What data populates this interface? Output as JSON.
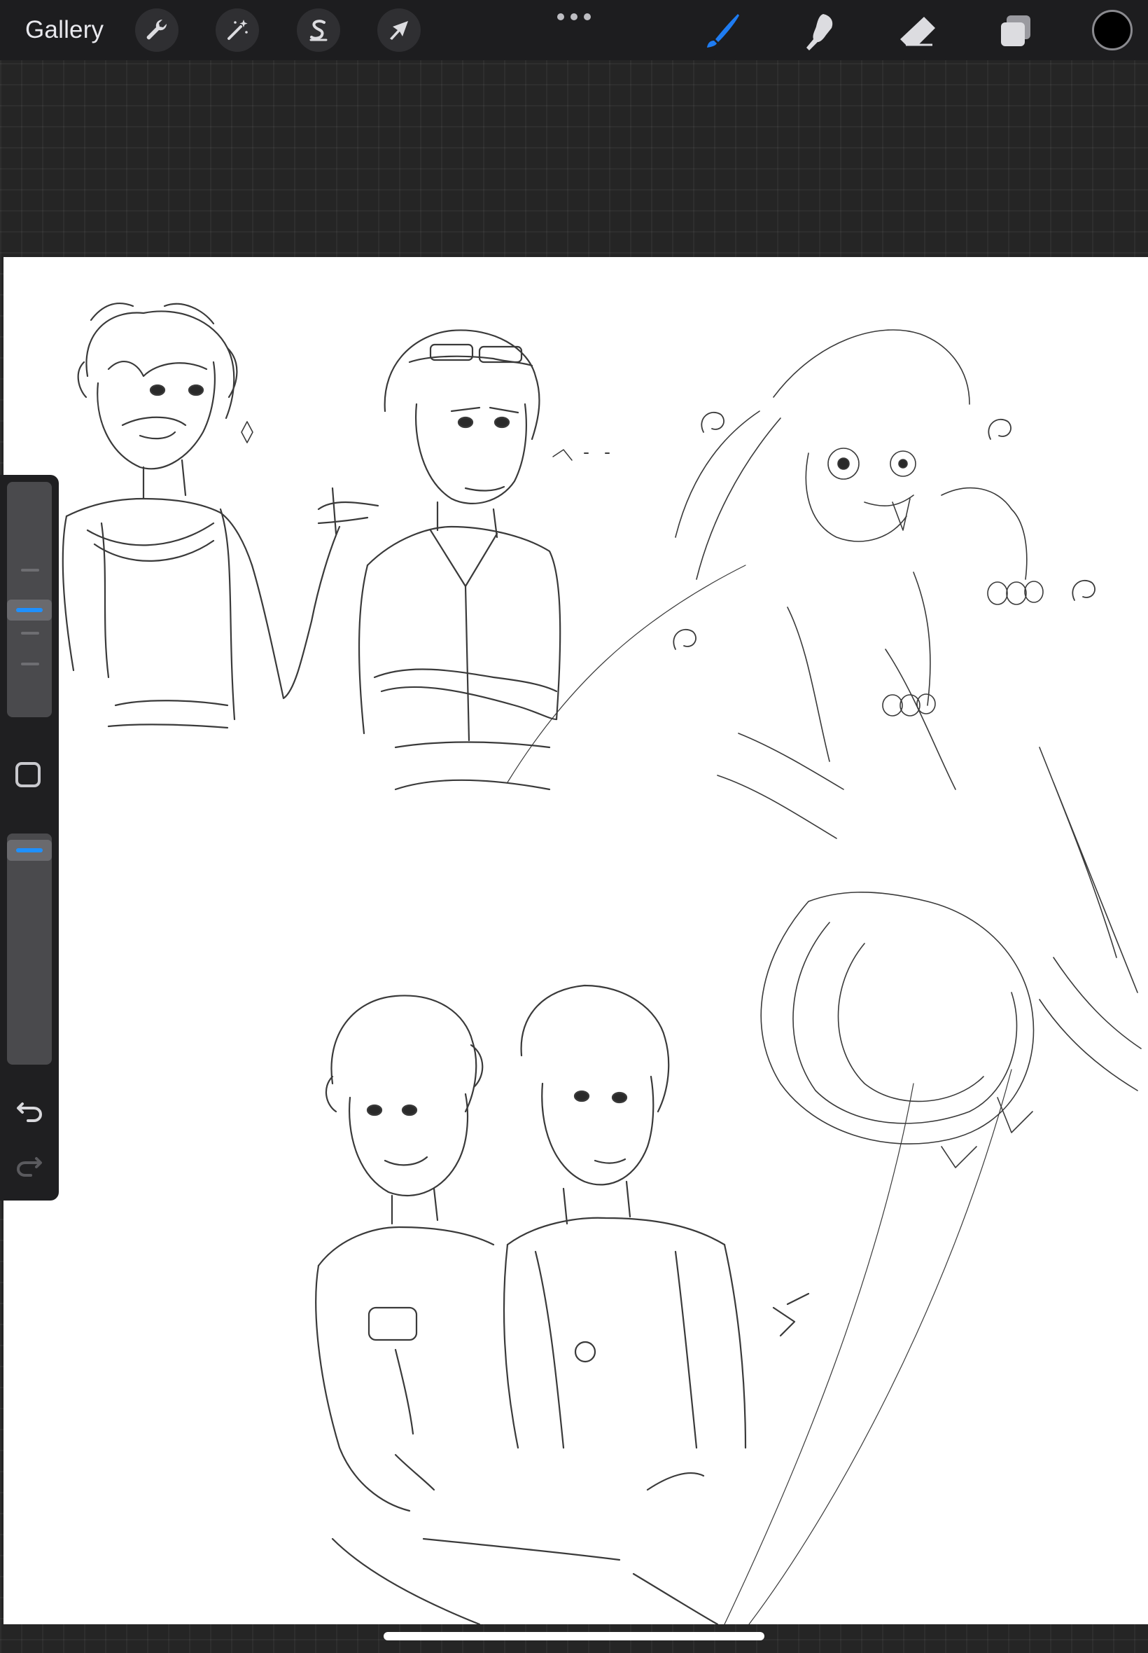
{
  "topbar": {
    "gallery_label": "Gallery",
    "left_tools": [
      "wrench-icon",
      "magic-wand-icon",
      "selection-s-icon",
      "transform-arrow-icon"
    ],
    "right_tools": [
      "brush-icon",
      "smudge-icon",
      "eraser-icon",
      "layers-icon"
    ],
    "active_tool": "brush-icon",
    "accent_color": "#1e7cf2",
    "current_color": "#000000"
  },
  "sidebar": {
    "controls": [
      "brush-size-slider",
      "modify-button",
      "opacity-slider",
      "undo-icon",
      "redo-icon"
    ],
    "brush_size_level": 0.6,
    "opacity_level": 0.03,
    "accent_color": "#1e90ff"
  },
  "canvas": {
    "background": "#ffffff",
    "content": "pencil-sketch"
  }
}
